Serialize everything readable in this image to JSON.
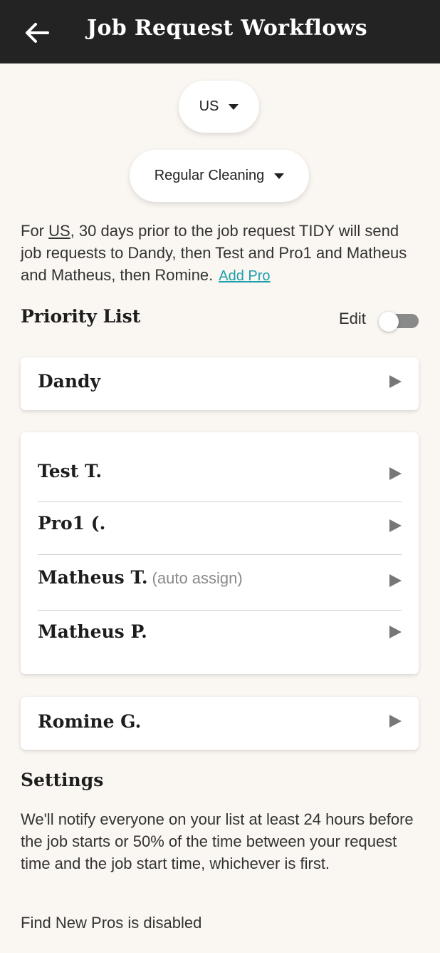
{
  "header": {
    "title": "Job Request Workflows",
    "back_icon": "arrow-left-icon"
  },
  "filters": {
    "country": "US",
    "service": "Regular Cleaning"
  },
  "description": {
    "prefix": "For ",
    "country": "US",
    "text": ", 30 days prior to the job request TIDY will send job requests to Dandy, then Test and Pro1 and Matheus and Matheus, then Romine.",
    "add_pro_label": "Add Pro"
  },
  "priority": {
    "title": "Priority List",
    "edit_label": "Edit",
    "edit_enabled": false,
    "groups": [
      {
        "pros": [
          {
            "name": "Dandy",
            "note": ""
          }
        ]
      },
      {
        "pros": [
          {
            "name": "Test T.",
            "note": ""
          },
          {
            "name": "Pro1 (.",
            "note": ""
          },
          {
            "name": "Matheus T.",
            "note": "(auto assign)"
          },
          {
            "name": "Matheus P.",
            "note": ""
          }
        ]
      },
      {
        "pros": [
          {
            "name": "Romine G.",
            "note": ""
          }
        ]
      }
    ]
  },
  "settings": {
    "title": "Settings",
    "notify_text": "We'll notify everyone on your list at least 24 hours before the job starts or 50% of the time between your request time and the job start time, whichever is first.",
    "find_new_pros": "Find New Pros is disabled"
  },
  "colors": {
    "header_bg": "#232323",
    "page_bg": "#faf6f1",
    "link": "#1f9fad"
  }
}
